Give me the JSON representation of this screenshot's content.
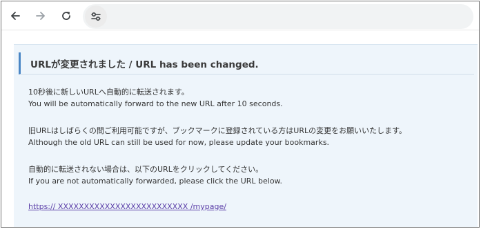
{
  "toolbar": {
    "icons": [
      "back-arrow-icon",
      "forward-arrow-icon",
      "reload-icon",
      "site-settings-icon"
    ]
  },
  "notice": {
    "heading": "URLが変更されました / URL has been changed.",
    "para1_ja": "10秒後に新しいURLへ自動的に転送されます。",
    "para1_en": "You will be automatically forward to the new URL after 10 seconds.",
    "para2_ja": "旧URLはしばらくの間ご利用可能ですが、ブックマークに登録されている方はURLの変更をお願いいたします。",
    "para2_en": "Although the old URL can still be used for now, please update your bookmarks.",
    "para3_ja": "自動的に転送されない場合は、以下のURLをクリックしてください。",
    "para3_en": "If you are not automatically forwarded, please click the URL below.",
    "link_text": "https://  XXXXXXXXXXXXXXXXXXXXXXXXX  /mypage/"
  },
  "colors": {
    "panel_background": "#eef5fb",
    "heading_accent": "#4a86c5",
    "link": "#5b3fa8"
  }
}
